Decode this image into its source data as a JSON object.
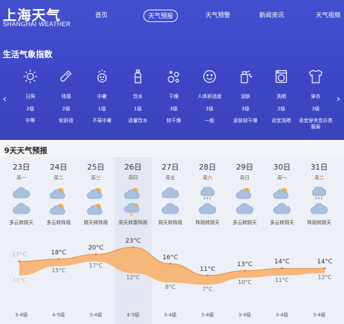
{
  "header": {
    "logo_cn": "上海天气",
    "logo_en": "SHANGHAI WEATHER",
    "nav": [
      {
        "label": "首页",
        "active": false
      },
      {
        "label": "天气预报",
        "active": true
      },
      {
        "label": "天气预警",
        "active": false
      },
      {
        "label": "新闻资讯",
        "active": false
      },
      {
        "label": "天气视频",
        "active": false
      }
    ],
    "brand_color": "#4250d0"
  },
  "life_index": {
    "title": "生活气象指数",
    "prev_arrow": "‹",
    "next_arrow": "›",
    "items": [
      {
        "icon": "sun-icon",
        "name": "日照",
        "level": "2级",
        "desc": "中等"
      },
      {
        "icon": "thermometer-icon",
        "name": "体感",
        "level": "2级",
        "desc": "较舒适"
      },
      {
        "icon": "heatstroke-icon",
        "name": "中暑",
        "level": "1级",
        "desc": "不易中暑"
      },
      {
        "icon": "water-bottle-icon",
        "name": "饮水",
        "level": "1级",
        "desc": "适量饮水"
      },
      {
        "icon": "dryness-icon",
        "name": "干燥",
        "level": "3级",
        "desc": "较干燥"
      },
      {
        "icon": "smile-icon",
        "name": "人体舒适度",
        "level": "3级",
        "desc": "一般"
      },
      {
        "icon": "moisturize-icon",
        "name": "润肤",
        "level": "3级",
        "desc": "皮肤较干燥"
      },
      {
        "icon": "washing-machine-icon",
        "name": "洗晒",
        "level": "2级",
        "desc": "适宜洗晒"
      },
      {
        "icon": "shirt-icon",
        "name": "穿衣",
        "level": "3级",
        "desc": "适宜穿夹克衫类服装"
      }
    ]
  },
  "forecast": {
    "title": "9天天气预报",
    "days": [
      {
        "date": "23日",
        "week": "周一",
        "weather": "多云转阴天",
        "high": "17°C",
        "low": "11°C",
        "wind": "3-4级",
        "icon1": "cloudy-icon",
        "icon2": "cloudy-icon"
      },
      {
        "date": "24日",
        "week": "周二",
        "weather": "多云转阵雨",
        "high": "18°C",
        "low": "15°C",
        "wind": "4-5级",
        "icon1": "partly-cloudy-icon",
        "icon2": "partly-cloudy-icon"
      },
      {
        "date": "25日",
        "week": "周三",
        "weather": "阴天转阵雨",
        "high": "20°C",
        "low": "17°C",
        "wind": "3-4级",
        "icon1": "partly-cloudy-icon",
        "icon2": "partly-cloudy-icon"
      },
      {
        "date": "26日",
        "week": "周四",
        "weather": "阴天转雷阵雨",
        "high": "23°C",
        "low": "12°C",
        "wind": "4-5级",
        "icon1": "partly-cloudy-icon",
        "icon2": "thunderstorm-icon"
      },
      {
        "date": "27日",
        "week": "周五",
        "weather": "阴天转阵雨",
        "high": "16°C",
        "low": "8°C",
        "wind": "3-4级",
        "icon1": "cloudy-icon",
        "icon2": "cloudy-icon"
      },
      {
        "date": "28日",
        "week": "周六",
        "weather": "阵雨转阴天",
        "high": "11°C",
        "low": "7°C",
        "wind": "3-4级",
        "icon1": "rain-icon",
        "icon2": "cloudy-icon"
      },
      {
        "date": "29日",
        "week": "周日",
        "weather": "多云转阴天",
        "high": "13°C",
        "low": "10°C",
        "wind": "3-4级",
        "icon1": "partly-cloudy-icon",
        "icon2": "cloudy-icon"
      },
      {
        "date": "30日",
        "week": "周一",
        "weather": "多云转阴天",
        "high": "14°C",
        "low": "11°C",
        "wind": "3-4级",
        "icon1": "partly-cloudy-icon",
        "icon2": "cloudy-icon"
      },
      {
        "date": "31日",
        "week": "周二",
        "weather": "阵雨转阴天",
        "high": "14°C",
        "low": "12°C",
        "wind": "3-4级",
        "icon1": "rain-icon",
        "icon2": "cloudy-icon"
      }
    ],
    "band_color": "#f6b77a",
    "line_color": "#e08a3c"
  },
  "chart_data": {
    "type": "area",
    "categories": [
      "23日",
      "24日",
      "25日",
      "26日",
      "27日",
      "28日",
      "29日",
      "30日",
      "31日"
    ],
    "series": [
      {
        "values": [
          17,
          18,
          20,
          23,
          16,
          11,
          13,
          14,
          14
        ]
      },
      {
        "values": [
          11,
          15,
          17,
          12,
          8,
          7,
          10,
          11,
          12
        ]
      }
    ],
    "ylim": [
      5,
      25
    ]
  }
}
